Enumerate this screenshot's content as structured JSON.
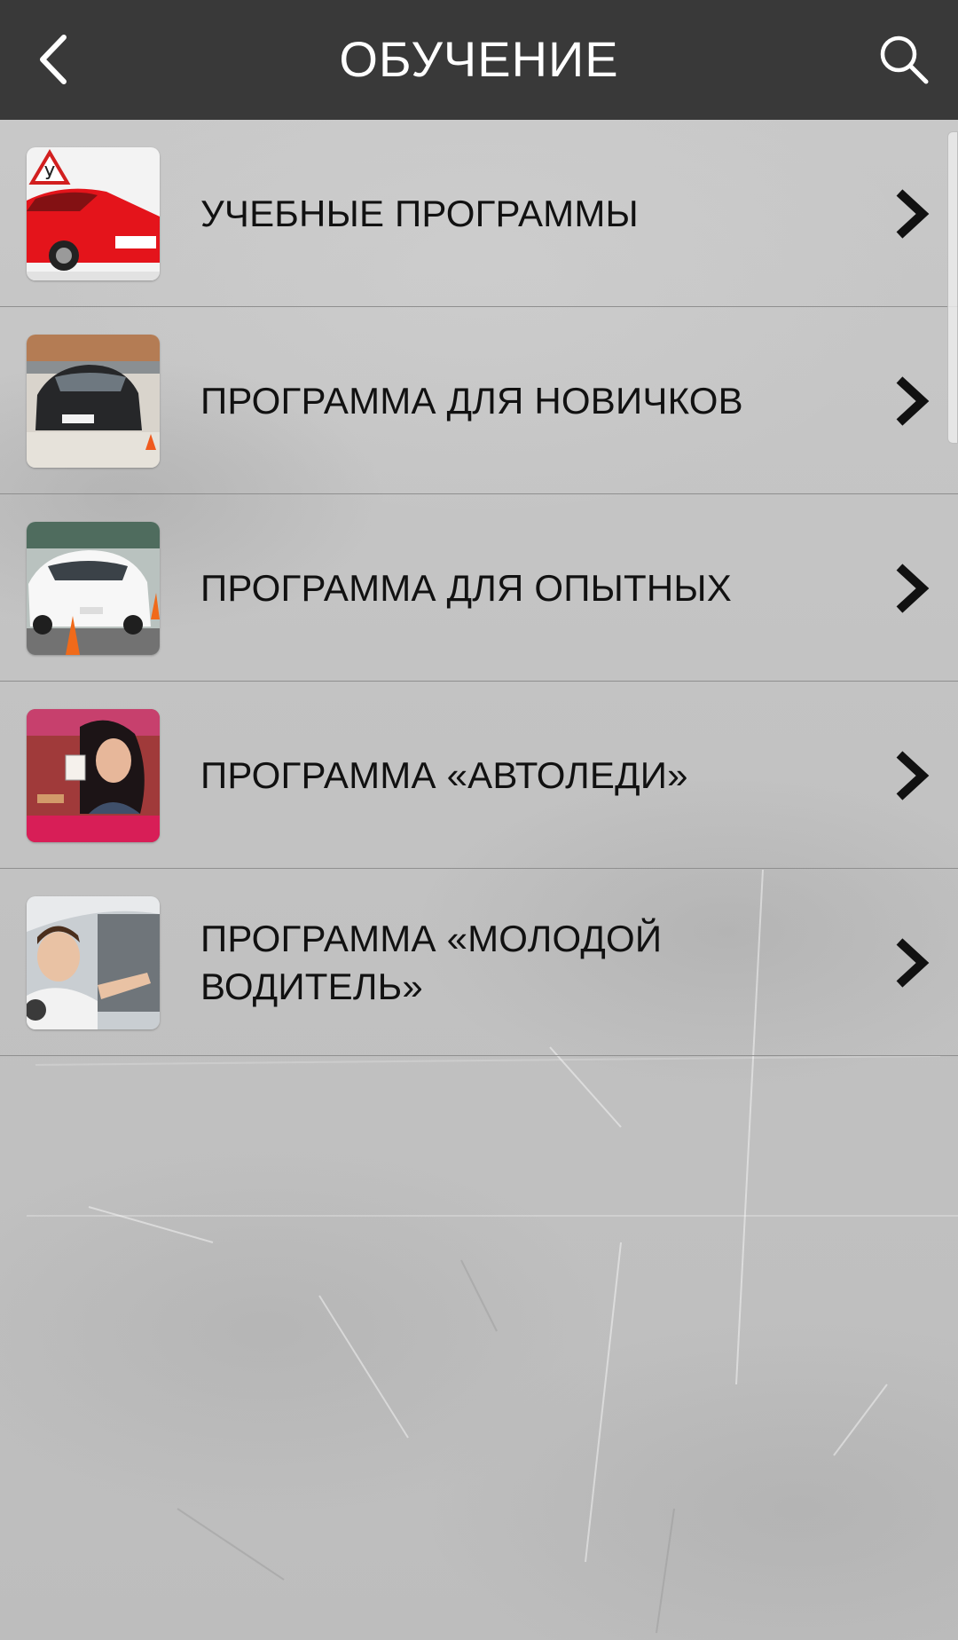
{
  "header": {
    "title": "ОБУЧЕНИЕ",
    "back_icon": "chevron-left-icon",
    "search_icon": "search-icon"
  },
  "items": [
    {
      "label": "УЧЕБНЫЕ ПРОГРАММЫ",
      "thumbnail": "red-car-student-sign-photo"
    },
    {
      "label": "ПРОГРАММА ДЛЯ НОВИЧКОВ",
      "thumbnail": "black-car-driving-course-photo"
    },
    {
      "label": "ПРОГРАММА ДЛЯ ОПЫТНЫХ",
      "thumbnail": "white-car-cones-photo"
    },
    {
      "label": "ПРОГРАММА «АВТОЛЕДИ»",
      "thumbnail": "woman-with-license-photo"
    },
    {
      "label": "ПРОГРАММА «МОЛОДОЙ ВОДИТЕЛЬ»",
      "thumbnail": "young-driver-photo"
    }
  ],
  "colors": {
    "header_bg": "#393939",
    "header_text": "#ffffff",
    "item_text": "#111111",
    "divider": "#8f8f8f",
    "background": "#c2c2c2"
  }
}
